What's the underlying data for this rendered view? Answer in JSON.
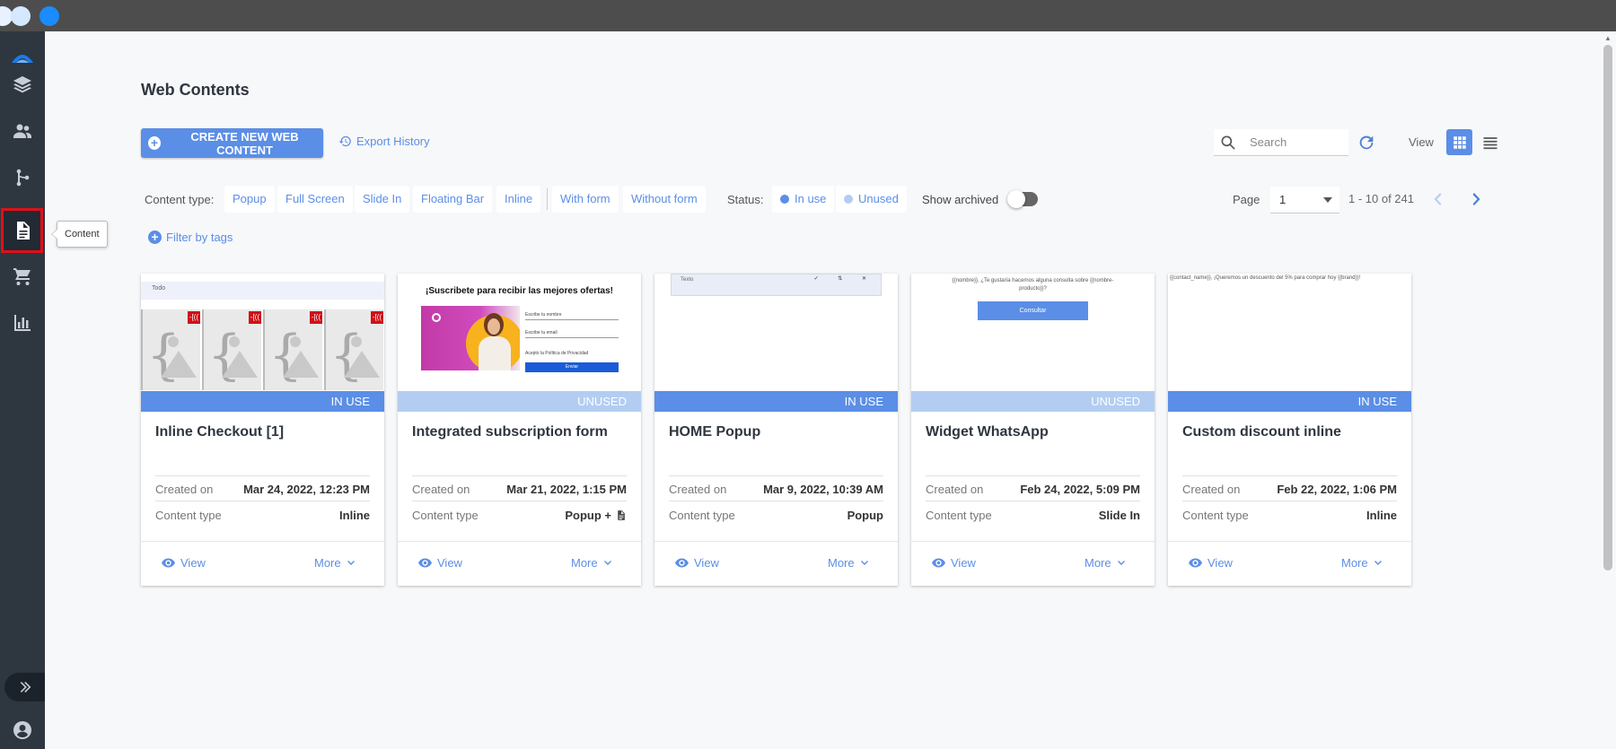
{
  "sidebar": {
    "tooltip": "Content",
    "items": [
      "logo",
      "layers",
      "contacts",
      "automation",
      "content",
      "cart",
      "reports"
    ]
  },
  "page": {
    "title": "Web Contents",
    "create_button": "CREATE NEW WEB CONTENT",
    "export_history": "Export History",
    "search_placeholder": "Search",
    "view_label": "View"
  },
  "filters": {
    "content_type_label": "Content type:",
    "content_types": [
      "Popup",
      "Full Screen",
      "Slide In",
      "Floating Bar",
      "Inline"
    ],
    "form_types": [
      "With form",
      "Without form"
    ],
    "status_label": "Status:",
    "status_in_use": "In use",
    "status_unused": "Unused",
    "show_archived": "Show archived",
    "filter_by_tags": "Filter by tags"
  },
  "pagination": {
    "label": "Page",
    "current": "1",
    "range": "1 - 10 of 241"
  },
  "colors": {
    "accent": "#5b8ee6",
    "in_use": "#5b8ee6",
    "unused": "#b3cdf2",
    "sidebar": "#2e3640",
    "active_outline": "#e0101a"
  },
  "cards": [
    {
      "status": "IN USE",
      "title": "Inline Checkout [1]",
      "created_label": "Created on",
      "created": "Mar 24, 2022, 12:23 PM",
      "type_label": "Content type",
      "type": "Inline",
      "view": "View",
      "more": "More",
      "thumb": {
        "head": "Todo",
        "tile_badge": "-[(("
      }
    },
    {
      "status": "UNUSED",
      "title": "Integrated subscription form",
      "created_label": "Created on",
      "created": "Mar 21, 2022, 1:15 PM",
      "type_label": "Content type",
      "type": "Popup +",
      "view": "View",
      "more": "More",
      "thumb": {
        "title": "¡Suscribete para recibir las mejores ofertas!",
        "field1": "Escribe tu nombre",
        "field2": "Escribe tu email",
        "check": "Acepto la Política de Privacidad",
        "button": "Enviar"
      }
    },
    {
      "status": "IN USE",
      "title": "HOME Popup",
      "created_label": "Created on",
      "created": "Mar 9, 2022, 10:39 AM",
      "type_label": "Content type",
      "type": "Popup",
      "view": "View",
      "more": "More",
      "thumb": {
        "bar": "Texto",
        "ctrls": "✓ ⇅ ✕"
      }
    },
    {
      "status": "UNUSED",
      "title": "Widget WhatsApp",
      "created_label": "Created on",
      "created": "Feb 24, 2022, 5:09 PM",
      "type_label": "Content type",
      "type": "Slide In",
      "view": "View",
      "more": "More",
      "thumb": {
        "text": "{{nombre}}, ¿Te gustaría hacernos alguna consulta sobre {{nombre-producto}}?",
        "button": "Consultar"
      }
    },
    {
      "status": "IN USE",
      "title": "Custom discount inline",
      "created_label": "Created on",
      "created": "Feb 22, 2022, 1:06 PM",
      "type_label": "Content type",
      "type": "Inline",
      "view": "View",
      "more": "More",
      "thumb": {
        "text": "{{contact_name}}, ¡Queremos un descuento del 5% para comprar hoy {{brand}}!"
      }
    }
  ]
}
